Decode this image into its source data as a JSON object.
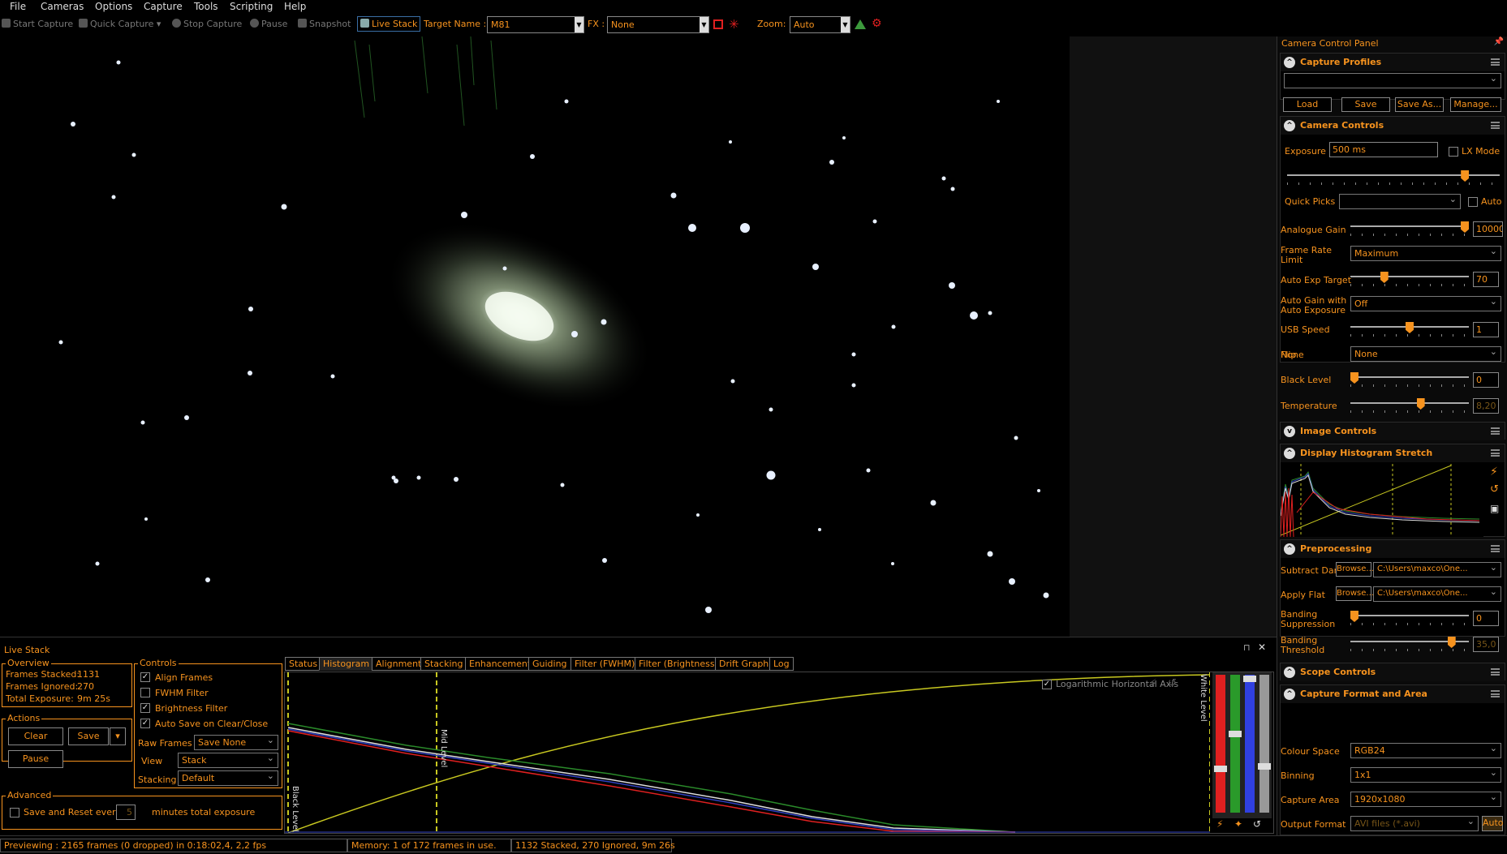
{
  "menu": [
    "File",
    "Cameras",
    "Options",
    "Capture",
    "Tools",
    "Scripting",
    "Help"
  ],
  "toolbar": {
    "start_capture": "Start Capture",
    "quick_capture": "Quick Capture",
    "stop_capture": "Stop Capture",
    "pause": "Pause",
    "snapshot": "Snapshot",
    "live_stack": "Live Stack",
    "target_name_label": "Target Name :",
    "target_name_value": "M81",
    "fx_label": "FX :",
    "fx_value": "None",
    "zoom_label": "Zoom:",
    "zoom_value": "Auto"
  },
  "panel": {
    "title": "Camera Control Panel",
    "capture_profiles": {
      "title": "Capture Profiles",
      "profile_value": "",
      "load": "Load",
      "save": "Save",
      "save_as": "Save As...",
      "manage": "Manage..."
    },
    "camera_controls": {
      "title": "Camera Controls",
      "exposure_label": "Exposure",
      "exposure_value": "500 ms",
      "exposure_level": 0.85,
      "lx_mode": "LX Mode",
      "quick_picks": "Quick Picks",
      "quick_picks_value": "",
      "auto": "Auto",
      "analogue_gain_label": "Analogue Gain",
      "analogue_gain_value": "10000",
      "analogue_gain_level": 1.0,
      "frame_rate_label_1": "Frame Rate",
      "frame_rate_label_2": "Limit",
      "frame_rate_value": "Maximum",
      "auto_exp_label": "Auto Exp Target",
      "auto_exp_value": "70",
      "auto_exp_level": 0.27,
      "auto_gain_label_1": "Auto Gain with",
      "auto_gain_label_2": "Auto Exposure",
      "auto_gain_value": "Off",
      "usb_speed_label": "USB Speed",
      "usb_speed_value": "1",
      "usb_speed_level": 0.5,
      "flip_label": "Flip",
      "flip_value": "None",
      "black_level_label": "Black Level",
      "black_level_value": "0",
      "black_level_level": 0.0,
      "temperature_label": "Temperature",
      "temperature_value": "8,20",
      "temperature_level": 0.6
    },
    "image_controls": {
      "title": "Image Controls"
    },
    "histogram_stretch": {
      "title": "Display Histogram Stretch"
    },
    "preprocessing": {
      "title": "Preprocessing",
      "subtract_dark": "Subtract Dark",
      "apply_flat": "Apply Flat",
      "browse": "Browse...",
      "dark_path": "C:\\Users\\maxco\\One...",
      "flat_path": "C:\\Users\\maxco\\One...",
      "banding_supp_1": "Banding",
      "banding_supp_2": "Suppression",
      "banding_supp_value": "0",
      "banding_supp_level": 0.0,
      "banding_thr_1": "Banding",
      "banding_thr_2": "Threshold",
      "banding_thr_value": "35,0",
      "banding_thr_level": 0.88
    },
    "scope_controls": {
      "title": "Scope Controls"
    },
    "capture_format": {
      "title": "Capture Format and Area",
      "colour_space_label": "Colour Space",
      "colour_space_value": "RGB24",
      "binning_label": "Binning",
      "binning_value": "1x1",
      "capture_area_label": "Capture Area",
      "capture_area_value": "1920x1080",
      "output_format_label": "Output Format",
      "output_format_value": "AVI files (*.avi)",
      "auto": "Auto"
    }
  },
  "livestack": {
    "title": "Live Stack",
    "overview": {
      "title": "Overview",
      "frames_stacked_label": "Frames Stacked:",
      "frames_stacked_value": "1131",
      "frames_ignored_label": "Frames Ignored:",
      "frames_ignored_value": "270",
      "total_exposure_label": "Total Exposure:",
      "total_exposure_value": "9m 25s"
    },
    "actions": {
      "title": "Actions",
      "clear": "Clear",
      "save": "Save",
      "pause": "Pause"
    },
    "advanced": {
      "title": "Advanced",
      "save_reset": "Save and Reset every",
      "minutes_value": "5",
      "minutes_label": "minutes total exposure"
    },
    "controls": {
      "title": "Controls",
      "align_frames": "Align Frames",
      "fwhm_filter": "FWHM Filter",
      "brightness_filter": "Brightness Filter",
      "auto_save": "Auto Save on Clear/Close",
      "raw_frames_label": "Raw Frames",
      "raw_frames_value": "Save None",
      "view_label": "View",
      "view_value": "Stack",
      "stacking_label": "Stacking",
      "stacking_value": "Default"
    },
    "tabs": [
      "Status",
      "Histogram",
      "Alignment",
      "Stacking",
      "Enhancement",
      "Guiding",
      "Filter (FWHM)",
      "Filter (Brightness)",
      "Drift Graph",
      "Log"
    ],
    "active_tab": "Histogram",
    "histogram": {
      "log_axis": "Logarithmic Horizontal Axis",
      "black_level": "Black Level",
      "mid_level": "Mid Level",
      "white_level": "White Level"
    }
  },
  "status": {
    "previewing": "Previewing : 2165 frames (0 dropped) in 0:18:02,4, 2,2 fps",
    "memory": "Memory: 1 of 172 frames in use.",
    "stacked": "1132 Stacked, 270 Ignored, 9m 26s"
  }
}
